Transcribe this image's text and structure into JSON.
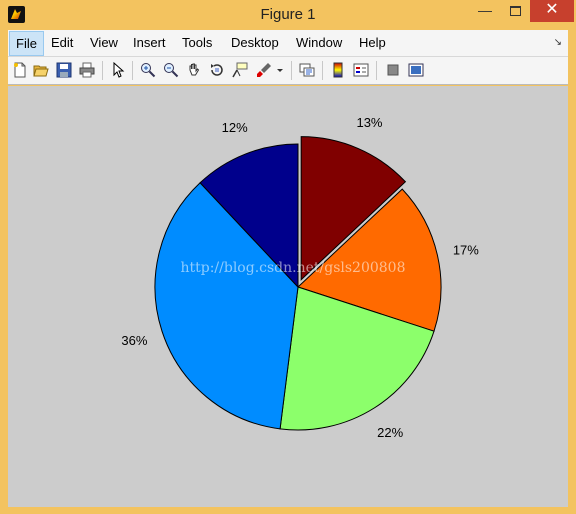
{
  "window": {
    "title": "Figure 1",
    "minimize_glyph": "—",
    "close_glyph": "✕"
  },
  "menu": {
    "file": "File",
    "edit": "Edit",
    "view": "View",
    "insert": "Insert",
    "tools": "Tools",
    "desktop": "Desktop",
    "window": "Window",
    "help": "Help"
  },
  "toolbar": {
    "icons": [
      "new-figure-icon",
      "open-file-icon",
      "save-icon",
      "print-icon",
      "edit-plot-arrow-icon",
      "zoom-in-icon",
      "zoom-out-icon",
      "pan-hand-icon",
      "rotate-3d-icon",
      "data-cursor-icon",
      "brush-icon",
      "brush-dropdown-icon",
      "link-plot-icon",
      "colorbar-icon",
      "legend-icon",
      "hide-plot-tools-icon",
      "show-plot-tools-icon"
    ]
  },
  "watermark": "http://blog.csdn.net/gsls200808",
  "chart_data": {
    "type": "pie",
    "slices": [
      {
        "label": "13%",
        "value": 13,
        "color": "#800000",
        "exploded": true
      },
      {
        "label": "17%",
        "value": 17,
        "color": "#ff6a00"
      },
      {
        "label": "22%",
        "value": 22,
        "color": "#8cff6b"
      },
      {
        "label": "36%",
        "value": 36,
        "color": "#008cff"
      },
      {
        "label": "12%",
        "value": 12,
        "color": "#00008c"
      }
    ],
    "direction": "clockwise",
    "start": "top"
  }
}
